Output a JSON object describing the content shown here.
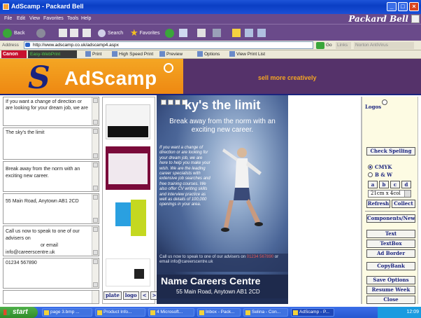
{
  "window": {
    "title": "AdScamp - Packard Bell"
  },
  "menu": {
    "items": [
      "File",
      "Edit",
      "View",
      "Favorites",
      "Tools",
      "Help"
    ],
    "brand": "Packard Bell"
  },
  "toolbar": {
    "back": "Back",
    "search": "Search",
    "favorites": "Favorites"
  },
  "address": {
    "label": "Address",
    "url": "http://www.adscamp.co.uk/adscamp4.aspx",
    "go": "Go",
    "links": "Links",
    "norton": "Norton AntiVirus"
  },
  "canon": {
    "brand": "Canon",
    "easy": "Easy-WebPrint",
    "buttons": [
      "Print",
      "High Speed Print",
      "Preview",
      "Options",
      "View Print List"
    ]
  },
  "banner": {
    "logo": "AdScamp",
    "tagline": "sell more creatively"
  },
  "editor": {
    "boxes": [
      {
        "text": "If you want a change of direction or are looking for your dream job, we are"
      },
      {
        "text": "The sky's the limit"
      },
      {
        "text": "Break away from the norm with an exciting new career."
      },
      {
        "text": "55 Main Road, Anytown AB1 2CD"
      },
      {
        "text": "Call us now to speak to one of our advisers on",
        "text2": "or email",
        "text3": "info@careerscentre.uk"
      },
      {
        "text": "01234 567890"
      },
      {
        "text": ""
      }
    ]
  },
  "thumbs": {
    "buttons": [
      "plate",
      "logo",
      "<",
      ">"
    ]
  },
  "poster": {
    "headline": "ky's the limit",
    "sub": "Break away from the norm with an exciting new career.",
    "body": "If you want a change of direction or are looking for your dream job, we are here to help you make your wish. We are the leading career specialists with extensive job searches and free training courses. We also offer CV writing skills and interview practice as well as details of 100,000 openings in your area.",
    "call": "Call us now to speak to one of our advisers on",
    "phone": "01234 567890",
    "email": "or email info@careerscentre.uk",
    "name": "Name Careers Centre",
    "address": "55 Main Road, Anytown AB1 2CD"
  },
  "panel": {
    "logos": "Logos",
    "check_spelling": "Check Spelling",
    "cmyk": "CMYK",
    "bw": "B & W",
    "letters": [
      "a",
      "b",
      "c",
      "d"
    ],
    "size": "21cm x 4col",
    "refresh": "Refresh",
    "collect": "Collect",
    "components": "Components/New",
    "text": "Text",
    "textbox": "TextBox",
    "ad_border": "Ad Border",
    "copybank": "CopyBank",
    "save_options": "Save Options",
    "resume_week": "Resume Week",
    "close": "Close"
  },
  "taskbar": {
    "start": "start",
    "tasks": [
      "page 3.bmp ...",
      "Product Info...",
      "4 Microsoft...",
      "Inbox - Pack...",
      "Selina - Con...",
      "AdScamp - P..."
    ],
    "clock": "12:09"
  }
}
